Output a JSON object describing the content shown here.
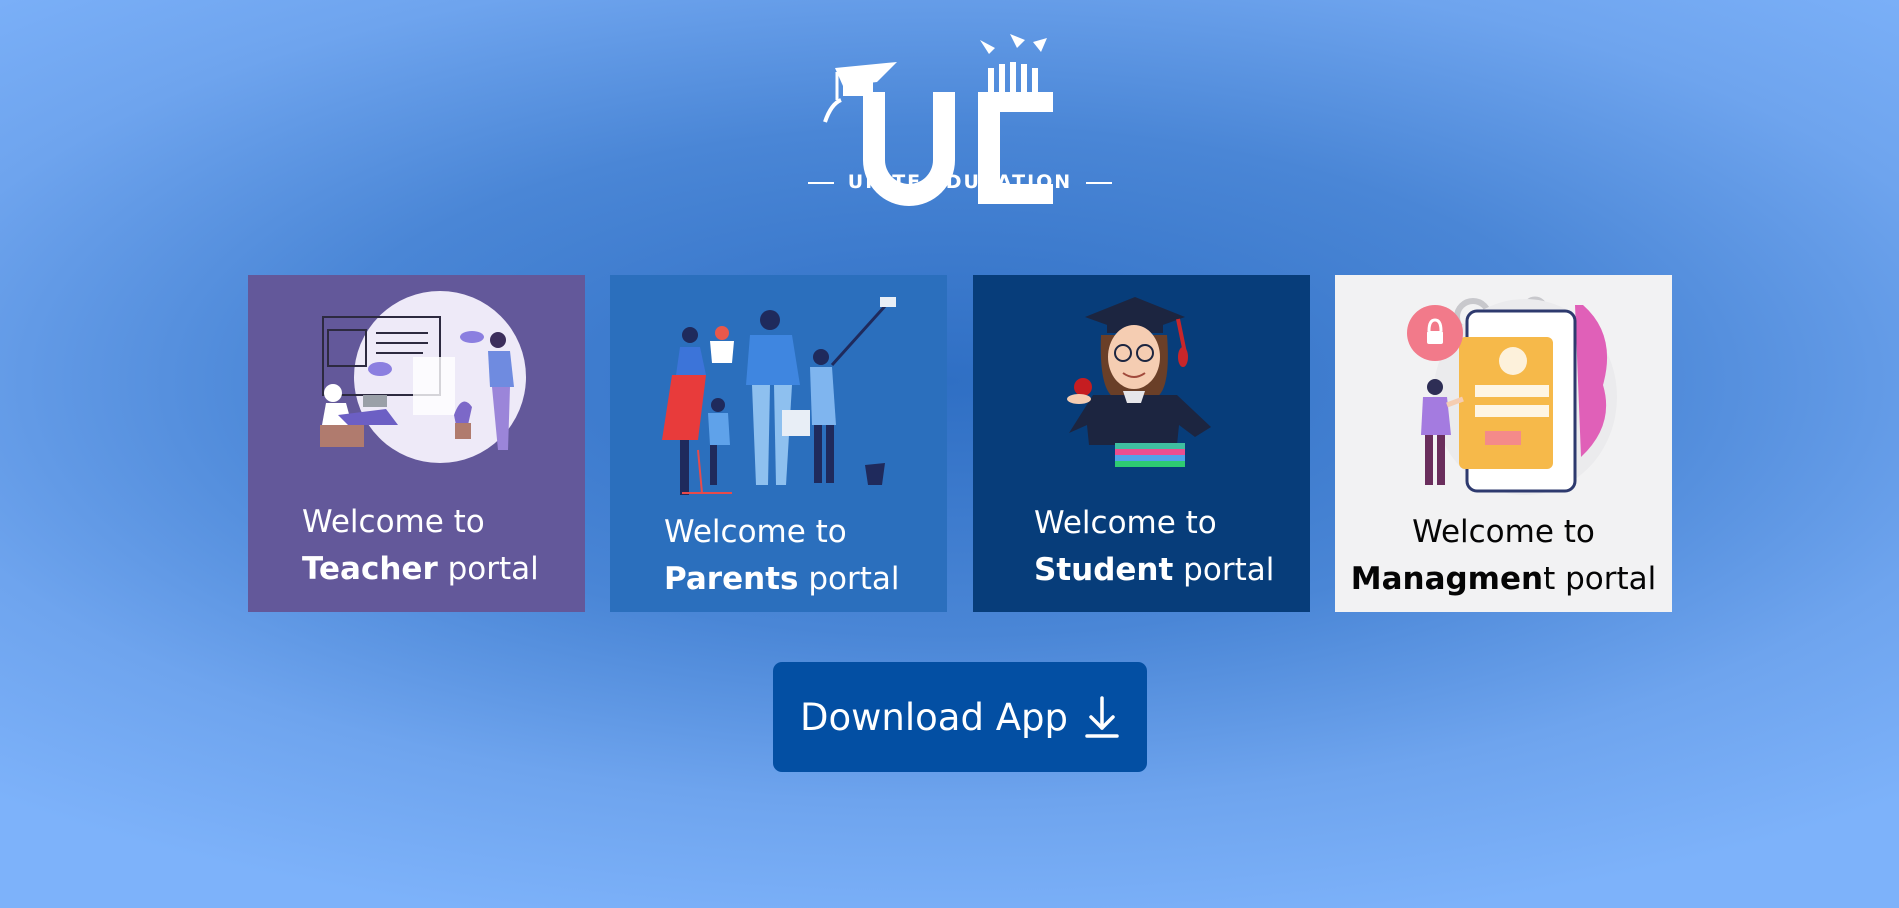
{
  "brand": {
    "logo_text": "UNITE EDUCATION",
    "colors": {
      "logo": "#ffffff",
      "button": "#034fa3"
    }
  },
  "portals": [
    {
      "greeting": "Welcome to",
      "name": "Teacher",
      "suffix": " portal",
      "bg": "#63589a",
      "text_color": "#ffffff"
    },
    {
      "greeting": "Welcome to",
      "name": "Parents",
      "suffix": " portal",
      "bg": "#2b6fbd",
      "text_color": "#ffffff"
    },
    {
      "greeting": "Welcome to",
      "name": "Student",
      "suffix": " portal",
      "bg": "#073d7a",
      "text_color": "#ffffff"
    },
    {
      "greeting": "Welcome to",
      "name": "Managmen",
      "suffix": "t portal",
      "bg": "#f2f2f3",
      "text_color": "#050505"
    }
  ],
  "download": {
    "label": "Download App",
    "icon": "download-arrow-icon"
  }
}
